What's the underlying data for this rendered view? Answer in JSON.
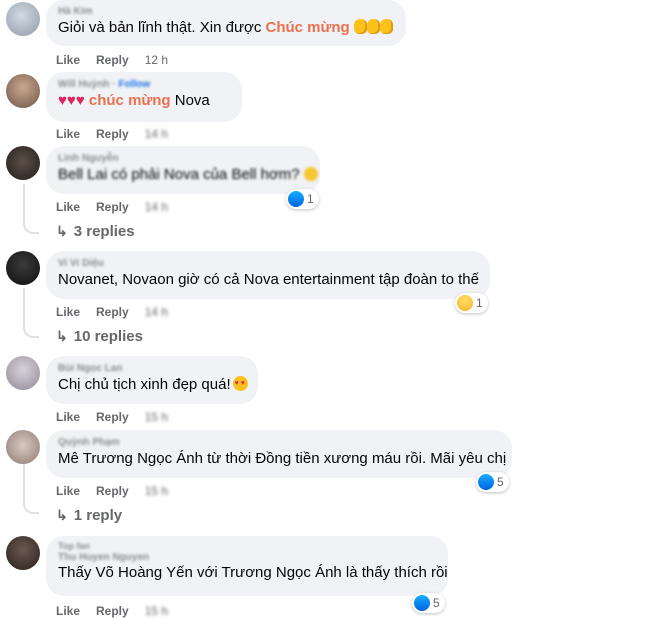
{
  "labels": {
    "like": "Like",
    "reply": "Reply"
  },
  "comments": [
    {
      "author": "Hà Kim",
      "segments": [
        "Giỏi và bản lĩnh thật. Xin được ",
        "Chúc mừng",
        ""
      ],
      "time": "12 h"
    },
    {
      "author": "Will Huỳnh",
      "author_extra": "Follow",
      "segments": [
        "",
        "chúc mừng",
        " Nova"
      ],
      "time": "14 h"
    },
    {
      "author": "Linh Nguyễn",
      "text": "Bell Lai có phải Nova của Bell hơm?",
      "time": "14 h",
      "reaction_count": "1",
      "replies": "3 replies"
    },
    {
      "author": "Vi Vi Diệu",
      "text": "Novanet, Novaon giờ có cả Nova entertainment tập đoàn to thế",
      "time": "14 h",
      "reaction_count": "1",
      "replies": "10 replies"
    },
    {
      "author": "Bùi Ngọc Lan",
      "text": "Chị chủ tịch xinh đẹp quá!",
      "time": "15 h"
    },
    {
      "author": "Quỳnh Phạm",
      "text": "Mê Trương Ngọc Ánh từ thời Đồng tiền xương máu rồi. Mãi yêu chị",
      "time": "15 h",
      "reaction_count": "5",
      "replies": "1 reply"
    },
    {
      "author": "Thu Huyen Nguyen",
      "author_badge": "Top fan",
      "text": "Thấy Võ Hoàng Yến với Trương Ngọc Ánh là thấy thích rồi",
      "time": "15 h",
      "reaction_count": "5"
    }
  ],
  "icons": {
    "like": "like-reaction-icon",
    "haha": "haha-reaction-icon",
    "reply_arrow": "reply-arrow-icon"
  }
}
